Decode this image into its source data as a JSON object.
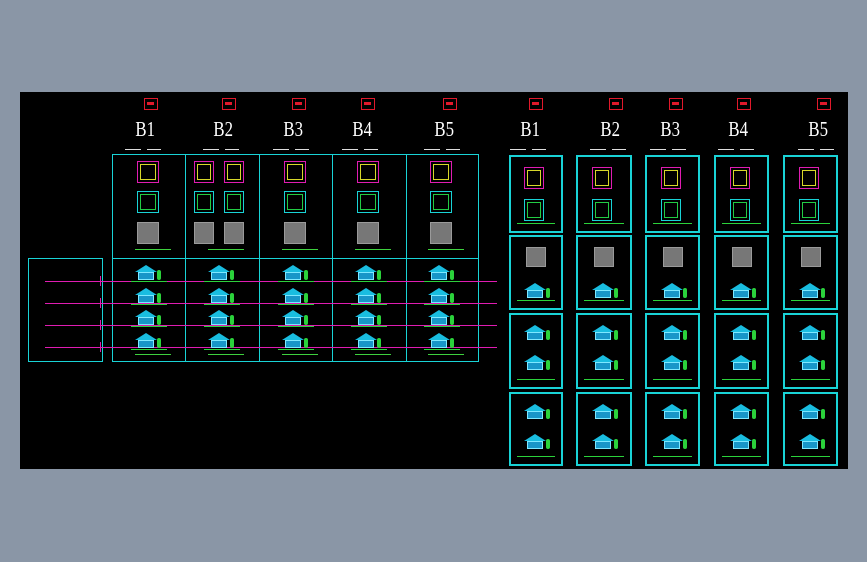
{
  "drawing": {
    "left_sheet_titles": [
      "B1",
      "B2",
      "B3",
      "B4",
      "B5"
    ],
    "right_sheet_titles": [
      "B1",
      "B2",
      "B3",
      "B4",
      "B5"
    ]
  },
  "colors": {
    "background": "#000000",
    "frame": "#19d3d6",
    "section_line": "#e01cb2",
    "tag": "#e0192b",
    "greenery": "#2bd23b"
  }
}
